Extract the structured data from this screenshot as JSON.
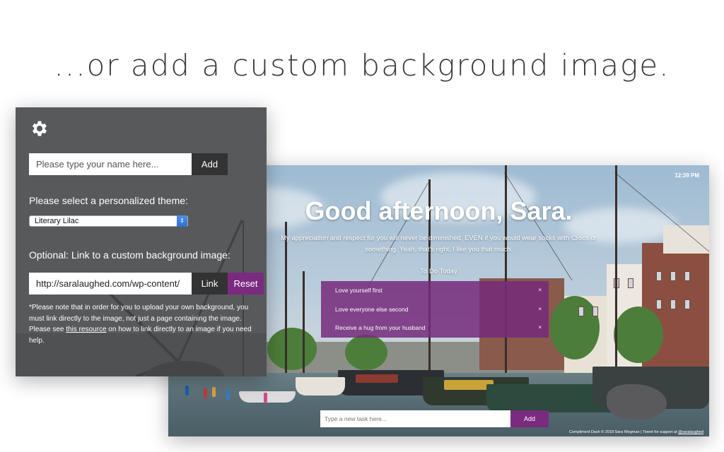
{
  "headline": "...or add a custom background image.",
  "settings": {
    "icon": "gear-icon",
    "name_placeholder": "Please type your name here...",
    "name_add_label": "Add",
    "theme_label": "Please select a personalized theme:",
    "theme_selected": "Literary Lilac",
    "bg_label": "Optional: Link to a custom background image:",
    "bg_url_value": "http://saralaughed.com/wp-content/",
    "link_label": "Link",
    "reset_label": "Reset",
    "note_before": "*Please note that in order for you to upload your own background, you must link directly to the image, not just a page containing the image. Please see ",
    "note_link": "this resource",
    "note_after": " on how to link directly to an image if you need help."
  },
  "preview": {
    "time": "12:39 PM",
    "greeting": "Good afternoon, Sara.",
    "compliment": "My appreciation and respect for you will never be diminished, EVEN if you would wear socks with Crocs or something. Yeah, that's right. I like you that much.",
    "todo_title": "To Do Today",
    "todos": [
      {
        "text": "Love yourself first",
        "remove": "×"
      },
      {
        "text": "Love everyone else second",
        "remove": "×"
      },
      {
        "text": "Receive a hug from your husband",
        "remove": "×"
      }
    ],
    "task_placeholder": "Type a new task here...",
    "task_add_label": "Add",
    "footer_text": "Compliment Dash © 2018 Sara Wegman | Tweet for support at ",
    "footer_handle": "@saralaughed"
  },
  "colors": {
    "accent_purple": "#7a2b80",
    "panel_gray": "#59595a",
    "button_dark": "#333333"
  }
}
